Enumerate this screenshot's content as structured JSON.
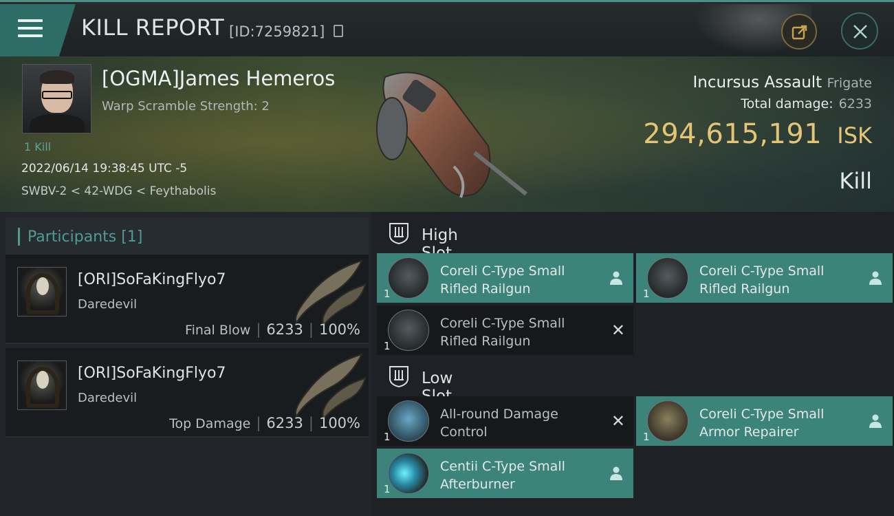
{
  "header": {
    "title": "KILL REPORT",
    "report_id": "[ID:7259821]",
    "menu_icon": "hamburger-icon",
    "share_icon": "external-link-icon",
    "close_icon": "close-icon"
  },
  "victim": {
    "pilot": "[OGMA]James Hemeros",
    "warp_scramble": "Warp Scramble Strength: 2",
    "kills": "1 Kill",
    "datetime": "2022/06/14 19:38:45 UTC -5",
    "location": "SWBV-2 < 42-WDG < Feythabolis",
    "ship_name": "Incursus Assault",
    "ship_class": "Frigate",
    "total_damage_label": "Total damage:",
    "total_damage": "6233",
    "isk_value": "294,615,191",
    "isk_unit": "ISK",
    "result": "Kill"
  },
  "participants": {
    "title": "Participants",
    "count": "[1]",
    "entries": [
      {
        "name": "[ORI]SoFaKingFlyo7",
        "ship": "Daredevil",
        "role": "Final Blow",
        "damage": "6233",
        "percent": "100%"
      },
      {
        "name": "[ORI]SoFaKingFlyo7",
        "ship": "Daredevil",
        "role": "Top Damage",
        "damage": "6233",
        "percent": "100%"
      }
    ]
  },
  "fitting": {
    "high_slot_label": "High Slot",
    "low_slot_label": "Low Slot",
    "high": [
      {
        "name": "Coreli C-Type Small Rifled Railgun",
        "qty": "1",
        "status": "dropped"
      },
      {
        "name": "Coreli C-Type Small Rifled Railgun",
        "qty": "1",
        "status": "dropped"
      },
      {
        "name": "Coreli C-Type Small Rifled Railgun",
        "qty": "1",
        "status": "destroyed"
      }
    ],
    "low": [
      {
        "name": "All-round Damage Control",
        "qty": "1",
        "status": "destroyed"
      },
      {
        "name": "Coreli C-Type Small Armor Repairer",
        "qty": "1",
        "status": "dropped"
      },
      {
        "name": "Centii C-Type Small Afterburner",
        "qty": "1",
        "status": "dropped"
      }
    ]
  },
  "colors": {
    "accent": "#4f9c93",
    "dropped_bg": "#3c837a",
    "isk": "#e6c475"
  }
}
